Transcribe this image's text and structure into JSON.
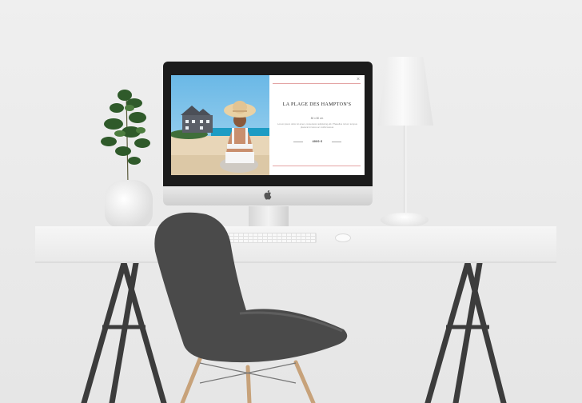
{
  "product_modal": {
    "title": "LA PLAGE DES HAMPTON'S",
    "dimensions": "80 x 80 cm",
    "description": "Lorem ipsum dolor sit amet, consectetur adipiscing elit. Phasellus rutrum tempus placerat in lacus ac mollis laoreet.",
    "price": "4000 €",
    "close_symbol": "×"
  },
  "colors": {
    "accent_rule": "#e4a4a4",
    "sky": "#7fc3e9",
    "sea": "#1d9cc4",
    "sand": "#e8d6b8"
  },
  "icons": {
    "close": "close-icon",
    "brand": "apple-logo-icon"
  }
}
